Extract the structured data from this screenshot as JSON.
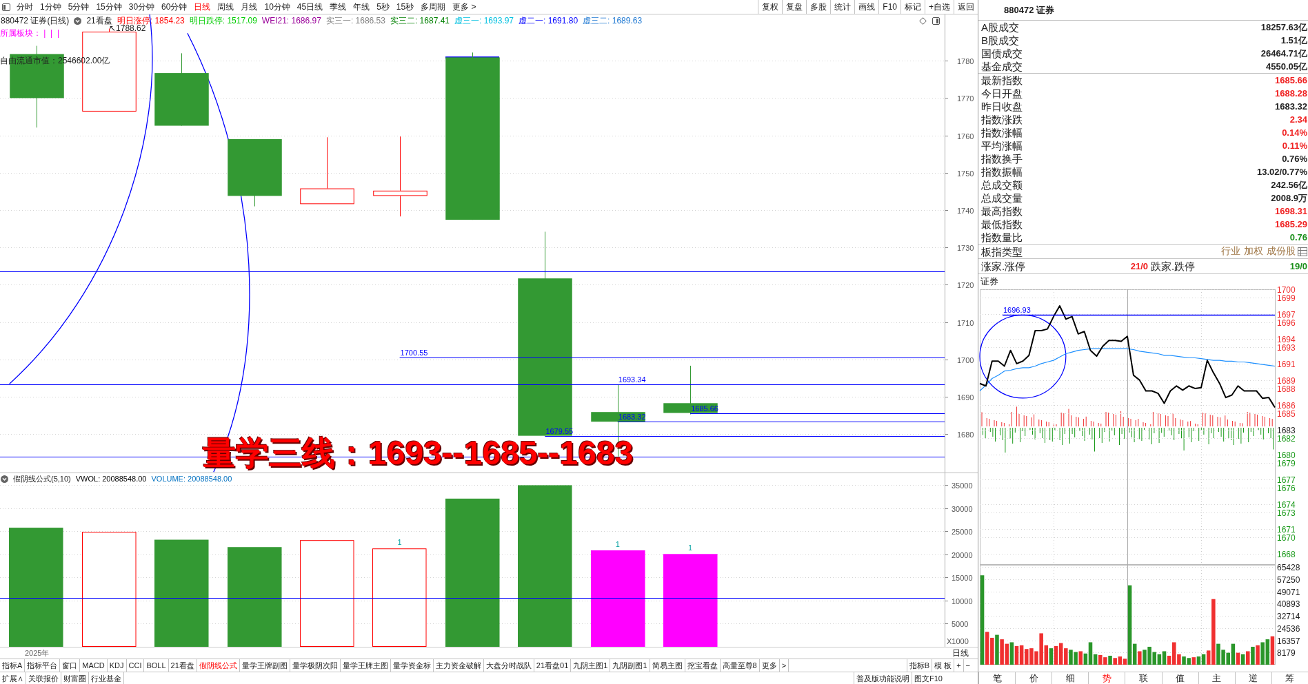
{
  "toolbar": {
    "periods": [
      {
        "label": "分时",
        "selected": false
      },
      {
        "label": "1分钟",
        "selected": false
      },
      {
        "label": "5分钟",
        "selected": false
      },
      {
        "label": "15分钟",
        "selected": false
      },
      {
        "label": "30分钟",
        "selected": false
      },
      {
        "label": "60分钟",
        "selected": false
      },
      {
        "label": "日线",
        "selected": true
      },
      {
        "label": "周线",
        "selected": false
      },
      {
        "label": "月线",
        "selected": false
      },
      {
        "label": "10分钟",
        "selected": false
      },
      {
        "label": "45日线",
        "selected": false
      },
      {
        "label": "季线",
        "selected": false
      },
      {
        "label": "年线",
        "selected": false
      },
      {
        "label": "5秒",
        "selected": false
      },
      {
        "label": "15秒",
        "selected": false
      },
      {
        "label": "多周期",
        "selected": false
      },
      {
        "label": "更多 >",
        "selected": false
      }
    ],
    "actions": [
      "复权",
      "复盘",
      "多股",
      "统计",
      "画线",
      "F10",
      "标记",
      "+自选",
      "返回"
    ]
  },
  "chart_header": {
    "title": "880472 证券(日线)",
    "indicator": "21看盘",
    "values": [
      {
        "label": "明日涨停: 1854.23",
        "color": "#ff0000"
      },
      {
        "label": "明日跌停: 1517.09",
        "color": "#00cc00"
      },
      {
        "label": "WEI21: 1686.97",
        "color": "#990099"
      },
      {
        "label": "实三一: 1686.53",
        "color": "#808080"
      },
      {
        "label": "实三二: 1687.41",
        "color": "#008000"
      },
      {
        "label": "虚三一: 1693.97",
        "color": "#00c0e0"
      },
      {
        "label": "虚二一: 1691.80",
        "color": "#0000ff"
      },
      {
        "label": "虚三二: 1689.63",
        "color": "#1e78d2"
      }
    ],
    "sector": "所属板块： |  |  |",
    "float_cap": "自由流通市值：2546602.00亿"
  },
  "price_chart": {
    "chart_data": {
      "type": "bar",
      "categories": [
        null,
        null,
        null,
        null,
        null,
        null,
        null,
        null,
        null,
        null,
        null,
        null,
        null
      ],
      "ylim": [
        1669.7,
        1792.4
      ],
      "yticks": [
        1680,
        1690,
        1700,
        1710,
        1720,
        1730,
        1740,
        1750,
        1760,
        1770,
        1780
      ],
      "grid": true,
      "ref_lines": [
        {
          "axis": "y",
          "value": 1723.5
        },
        {
          "axis": "y",
          "value": 1700.55,
          "label": "1700.55"
        },
        {
          "axis": "y",
          "value": 1693.34,
          "label": "1693.34"
        },
        {
          "axis": "y",
          "value": 1685.66,
          "label": "1685.66"
        },
        {
          "axis": "y",
          "value": 1683.32,
          "label": "1683.32"
        },
        {
          "axis": "y",
          "value": 1679.55,
          "label": "1679.55"
        },
        {
          "axis": "y",
          "value": 1674.0
        }
      ],
      "annotations": [
        "↖1788.62"
      ]
    }
  },
  "volume_panel": {
    "title": "假阴线公式(5,10)",
    "legend": [
      {
        "label": "VWOL: 20088548.00",
        "color": "#000000"
      },
      {
        "label": "VOLUME: 20088548.00",
        "color": "#0070c0"
      }
    ],
    "unit": "X1000",
    "year_label": "2025年",
    "period": "日线",
    "bar_marks": [
      {
        "marked": false
      },
      {
        "marked": false
      },
      {
        "marked": false
      },
      {
        "marked": false
      },
      {
        "marked": false
      },
      {
        "marked": true,
        "label": "1"
      },
      {
        "marked": false
      },
      {
        "marked": false
      },
      {
        "marked": true,
        "label": "1"
      },
      {
        "marked": true,
        "label": "1"
      }
    ],
    "chart_data": {
      "type": "bar",
      "stacked": true,
      "categories": [
        null,
        null,
        null,
        null,
        null,
        null,
        null,
        null,
        null,
        null,
        null,
        null,
        null
      ],
      "ylim": [
        0,
        37600
      ],
      "yticks": [
        5000,
        10000,
        15000,
        20000,
        25000,
        30000,
        35000
      ],
      "grid": true,
      "series": [
        {
          "color": "#339933",
          "values": [
            25800,
            null,
            23200,
            21600,
            null,
            null,
            32100,
            35000,
            null,
            null,
            null,
            null,
            null
          ]
        },
        {
          "color": "#ff0000",
          "values": [
            null,
            24900,
            null,
            null,
            23100,
            21300,
            null,
            null,
            null,
            null,
            null,
            null,
            null
          ]
        },
        {
          "color": "#ff00ff",
          "values": [
            null,
            null,
            null,
            null,
            null,
            null,
            null,
            null,
            20900,
            20100,
            null,
            null,
            null
          ]
        }
      ],
      "ref_lines": [
        {
          "axis": "y",
          "value": 10600
        }
      ]
    }
  },
  "overlay_note": "量学三线：1693--1685--1683",
  "indicator_tabs": [
    {
      "label": "指标A",
      "selected": false
    },
    {
      "label": "指标平台",
      "selected": false
    },
    {
      "label": "窗口",
      "selected": false
    },
    {
      "label": "MACD",
      "selected": false
    },
    {
      "label": "KDJ",
      "selected": false
    },
    {
      "label": "CCI",
      "selected": false
    },
    {
      "label": "BOLL",
      "selected": false
    },
    {
      "label": "21看盘",
      "selected": false
    },
    {
      "label": "假阴线公式",
      "selected": true
    },
    {
      "label": "量学王牌副图",
      "selected": false
    },
    {
      "label": "量学极阴次阳",
      "selected": false
    },
    {
      "label": "量学王牌主图",
      "selected": false
    },
    {
      "label": "量学资金标",
      "selected": false
    },
    {
      "label": "主力资金破解",
      "selected": false
    },
    {
      "label": "大盘分时战队",
      "selected": false
    },
    {
      "label": "21看盘01",
      "selected": false
    },
    {
      "label": "九阴主图1",
      "selected": false
    },
    {
      "label": "九阴副图1",
      "selected": false
    },
    {
      "label": "简易主图",
      "selected": false
    },
    {
      "label": "挖宝看盘",
      "selected": false
    },
    {
      "label": "高量至尊8",
      "selected": false
    },
    {
      "label": "更多",
      "selected": false
    },
    {
      "label": ">",
      "selected": false
    }
  ],
  "indicator_tools": [
    "指标B",
    "模 板",
    "+",
    "−"
  ],
  "bottom_links": [
    "扩展∧",
    "关联报价",
    "财富圈",
    "行业基金"
  ],
  "bottom_right_links": [
    "普及版功能说明",
    "图文F10"
  ],
  "quote_panel": {
    "title": "880472 证券",
    "groups": [
      [
        {
          "label": "A股成交",
          "value": "18257.63亿",
          "color": "#222222"
        },
        {
          "label": "B股成交",
          "value": "1.51亿",
          "color": "#222222"
        },
        {
          "label": "国债成交",
          "value": "26464.71亿",
          "color": "#222222"
        },
        {
          "label": "基金成交",
          "value": "4550.05亿",
          "color": "#222222"
        }
      ],
      [
        {
          "label": "最新指数",
          "value": "1685.66",
          "color": "#f02020"
        },
        {
          "label": "今日开盘",
          "value": "1688.28",
          "color": "#f02020"
        },
        {
          "label": "昨日收盘",
          "value": "1683.32",
          "color": "#222222"
        },
        {
          "label": "指数涨跌",
          "value": "2.34",
          "color": "#f02020"
        },
        {
          "label": "指数涨幅",
          "value": "0.14%",
          "color": "#f02020"
        },
        {
          "label": "平均涨幅",
          "value": "0.11%",
          "color": "#f02020"
        },
        {
          "label": "指数换手",
          "value": "0.76%",
          "color": "#222222"
        },
        {
          "label": "指数振幅",
          "value": "13.02/0.77%",
          "color": "#222222"
        },
        {
          "label": "总成交额",
          "value": "242.56亿",
          "color": "#222222"
        },
        {
          "label": "总成交量",
          "value": "2008.9万",
          "color": "#222222"
        },
        {
          "label": "最高指数",
          "value": "1698.31",
          "color": "#f02020"
        },
        {
          "label": "最低指数",
          "value": "1685.29",
          "color": "#f02020"
        },
        {
          "label": "指数量比",
          "value": "0.76",
          "color": "#1a8f1a"
        }
      ]
    ],
    "index_type": {
      "label": "板指类型",
      "links": [
        "行业",
        "加权",
        "成份股"
      ]
    },
    "breadth": {
      "up_label": "涨家.涨停",
      "up_value": "21/0",
      "down_label": "跌家.跌停",
      "down_value": "19/0"
    },
    "chart_label": "证券",
    "intraday_chart": {
      "chart_data": {
        "type": "line",
        "categories": [
          null,
          null,
          null,
          null,
          null,
          null,
          null,
          null,
          null,
          null,
          null,
          null,
          null,
          null,
          null,
          null,
          null,
          null,
          null,
          null,
          null,
          null,
          null,
          null,
          null,
          null,
          null,
          null,
          null,
          null,
          null,
          null,
          null,
          null,
          null,
          null,
          null,
          null,
          null,
          null,
          null,
          null,
          null,
          null,
          null,
          null,
          null,
          null,
          null
        ],
        "ylim": [
          1666.64,
          1700.0
        ],
        "grid": true,
        "yticks": [
          1700,
          1699,
          1697,
          1696,
          1694,
          1693,
          1691,
          1689,
          1688,
          1686,
          1685,
          1683,
          1682,
          1680,
          1679,
          1677,
          1676,
          1674,
          1673,
          1671,
          1670,
          1668
        ],
        "series": [
          {
            "color": "#000000",
            "values": [
              1688.6,
              1688.3,
              1691.3,
              1691.3,
              1690.7,
              1692.6,
              1691.0,
              1691.3,
              1692.0,
              1695.0,
              1695.0,
              1695.2,
              1696.7,
              1698.0,
              1696.4,
              1696.7,
              1694.6,
              1694.9,
              1692.6,
              1691.9,
              1693.1,
              1693.8,
              1693.8,
              1693.7,
              1694.3,
              1689.6,
              1689.0,
              1687.7,
              1687.7,
              1687.4,
              1686.2,
              1687.7,
              1688.3,
              1687.8,
              1688.3,
              1688.0,
              1688.1,
              1691.4,
              1689.9,
              1688.6,
              1686.9,
              1687.2,
              1688.3,
              1687.7,
              1687.7,
              1687.7,
              1686.8,
              1686.9,
              1685.7
            ]
          },
          {
            "color": "#1e90ff",
            "values": [
              1687.7,
              1688.4,
              1689.2,
              1689.6,
              1690.1,
              1690.2,
              1690.4,
              1690.5,
              1690.5,
              1690.7,
              1691.0,
              1691.2,
              1691.4,
              1691.8,
              1692.2,
              1692.4,
              1692.6,
              1692.7,
              1692.8,
              1692.8,
              1692.8,
              1692.8,
              1692.8,
              1692.8,
              1692.8,
              1692.7,
              1692.5,
              1692.4,
              1692.3,
              1692.2,
              1692.0,
              1692.0,
              1691.9,
              1691.8,
              1691.7,
              1691.7,
              1691.6,
              1691.5,
              1691.4,
              1691.4,
              1691.3,
              1691.3,
              1691.2,
              1691.2,
              1691.1,
              1691.0,
              1690.9,
              1690.8,
              1690.7
            ]
          }
        ],
        "ref_lines": [
          {
            "axis": "y",
            "value": 1696.93,
            "label": "1696.93"
          }
        ]
      }
    },
    "intraday_volume": {
      "chart_data": {
        "type": "bar",
        "stacked": true,
        "categories": [
          null,
          null,
          null,
          null,
          null,
          null,
          null,
          null,
          null,
          null,
          null,
          null,
          null,
          null,
          null,
          null,
          null,
          null,
          null,
          null,
          null,
          null,
          null,
          null,
          null,
          null,
          null,
          null,
          null,
          null,
          null,
          null,
          null,
          null,
          null,
          null,
          null,
          null,
          null,
          null,
          null,
          null,
          null,
          null,
          null,
          null,
          null,
          null,
          null,
          null,
          null,
          null,
          null,
          null,
          null,
          null,
          null,
          null,
          null,
          null
        ],
        "ylim": [
          0,
          65428
        ],
        "grid": true,
        "yticks": [
          65428,
          57250,
          49071,
          40893,
          32714,
          24536,
          16357,
          8179
        ],
        "series": [
          {
            "color": "#f03030",
            "values": [
              null,
              22000,
              18000,
              null,
              17000,
              14000,
              null,
              12500,
              13000,
              10500,
              11000,
              9000,
              21000,
              13000,
              null,
              12500,
              14500,
              11000,
              null,
              null,
              9000,
              null,
              null,
              null,
              6500,
              5000,
              null,
              4500,
              5500,
              4000,
              null,
              null,
              9000,
              null,
              null,
              null,
              null,
              null,
              6000,
              15000,
              7000,
              null,
              null,
              5000,
              null,
              null,
              9500,
              43900,
              null,
              null,
              null,
              null,
              8000,
              null,
              9000,
              null,
              13000,
              null,
              null,
              19000
            ]
          },
          {
            "color": "#2a962a",
            "values": [
              59800,
              null,
              null,
              20000,
              null,
              null,
              15000,
              null,
              null,
              null,
              null,
              null,
              null,
              null,
              11000,
              null,
              null,
              null,
              10000,
              8500,
              null,
              7500,
              15000,
              7000,
              null,
              null,
              6000,
              null,
              null,
              null,
              53100,
              14000,
              null,
              10000,
              12000,
              8500,
              7000,
              9000,
              null,
              null,
              null,
              5500,
              4500,
              null,
              5500,
              7000,
              null,
              null,
              14000,
              10000,
              8000,
              14000,
              null,
              7000,
              null,
              12000,
              null,
              15000,
              17000,
              null
            ]
          }
        ]
      }
    },
    "tabs": [
      {
        "label": "笔",
        "selected": false
      },
      {
        "label": "价",
        "selected": false
      },
      {
        "label": "细",
        "selected": false
      },
      {
        "label": "势",
        "selected": true
      },
      {
        "label": "联",
        "selected": false
      },
      {
        "label": "值",
        "selected": false
      },
      {
        "label": "主",
        "selected": false
      },
      {
        "label": "逆",
        "selected": false
      },
      {
        "label": "筹",
        "selected": false
      }
    ]
  }
}
